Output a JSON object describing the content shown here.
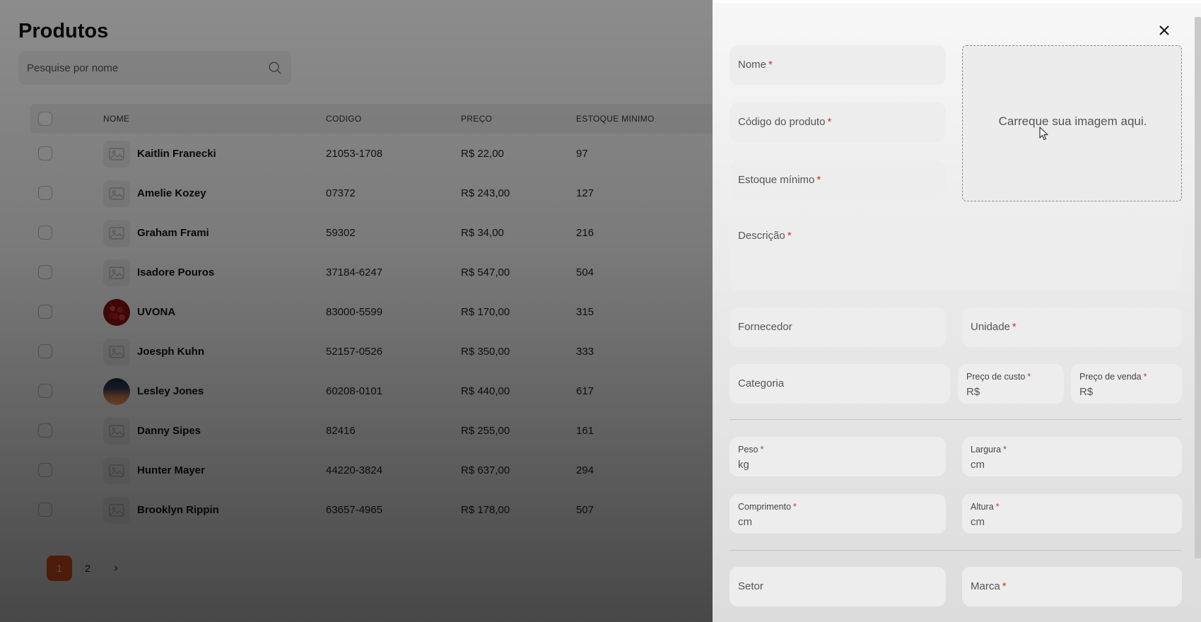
{
  "page": {
    "title": "Produtos",
    "search_placeholder": "Pesquise por nome"
  },
  "table": {
    "columns": [
      "NOME",
      "CODIGO",
      "PREÇO",
      "ESTOQUE MINIMO"
    ],
    "rows": [
      {
        "name": "Kaitlin Franecki",
        "code": "21053-1708",
        "price": "R$ 22,00",
        "stock": "97",
        "image": "placeholder-image-icon"
      },
      {
        "name": "Amelie Kozey",
        "code": "07372",
        "price": "R$ 243,00",
        "stock": "127",
        "image": "placeholder-image-icon"
      },
      {
        "name": "Graham Frami",
        "code": "59302",
        "price": "R$ 34,00",
        "stock": "216",
        "image": "placeholder-image-icon"
      },
      {
        "name": "Isadore Pouros",
        "code": "37184-6247",
        "price": "R$ 547,00",
        "stock": "504",
        "image": "placeholder-image-icon"
      },
      {
        "name": "UVONA",
        "code": "83000-5599",
        "price": "R$ 170,00",
        "stock": "315",
        "image": "grapes-photo"
      },
      {
        "name": "Joesph Kuhn",
        "code": "52157-0526",
        "price": "R$ 350,00",
        "stock": "333",
        "image": "placeholder-image-icon"
      },
      {
        "name": "Lesley Jones",
        "code": "60208-0101",
        "price": "R$ 440,00",
        "stock": "617",
        "image": "sunset-photo"
      },
      {
        "name": "Danny Sipes",
        "code": "82416",
        "price": "R$ 255,00",
        "stock": "161",
        "image": "placeholder-image-icon"
      },
      {
        "name": "Hunter Mayer",
        "code": "44220-3824",
        "price": "R$ 637,00",
        "stock": "294",
        "image": "placeholder-image-icon"
      },
      {
        "name": "Brooklyn Rippin",
        "code": "63657-4965",
        "price": "R$ 178,00",
        "stock": "507",
        "image": "placeholder-image-icon"
      }
    ]
  },
  "pagination": {
    "pages": [
      "1",
      "2"
    ],
    "current": "1",
    "next": "›"
  },
  "drawer": {
    "close": "×",
    "upload_text": "Carreque sua imagem aqui.",
    "required_mark": "*",
    "fields": {
      "nome": "Nome",
      "codigo": "Código do produto",
      "estoque": "Estoque mínimo",
      "descricao": "Descrição",
      "fornecedor": "Fornecedor",
      "unidade": "Unidade",
      "categoria": "Categoria",
      "preco_custo": "Preço de custo",
      "preco_venda": "Preço de venda",
      "peso": "Peso",
      "largura": "Largura",
      "comprimento": "Comprimento",
      "altura": "Altura",
      "setor": "Setor",
      "marca": "Marca"
    },
    "units": {
      "currency": "R$",
      "weight": "kg",
      "length": "cm"
    }
  },
  "colors": {
    "accent": "#ff5a1f",
    "required": "#d03030"
  }
}
